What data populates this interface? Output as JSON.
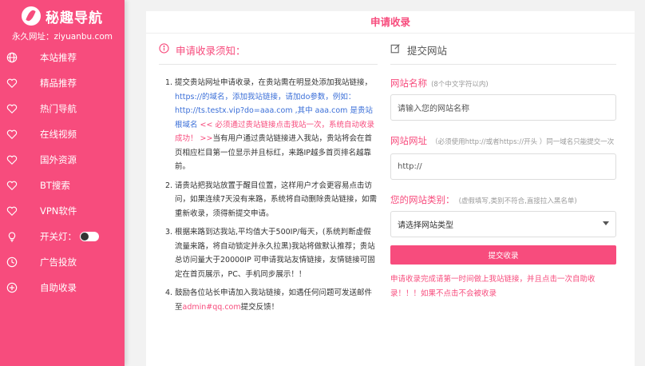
{
  "brand": {
    "name": "秘趣导航",
    "subtitle": "永久网址：ziyuanbu.com"
  },
  "nav": [
    {
      "label": "本站推荐",
      "icon": "globe-icon"
    },
    {
      "label": "精品推荐",
      "icon": "heart-icon"
    },
    {
      "label": "热门导航",
      "icon": "heart-icon"
    },
    {
      "label": "在线视频",
      "icon": "heart-icon"
    },
    {
      "label": "国外资源",
      "icon": "heart-icon"
    },
    {
      "label": "BT搜索",
      "icon": "heart-icon"
    },
    {
      "label": "VPN软件",
      "icon": "heart-icon"
    },
    {
      "label": "开关灯：",
      "icon": "lightbulb-icon"
    },
    {
      "label": "广告投放",
      "icon": "clock-icon"
    },
    {
      "label": "自助收录",
      "icon": "plus-circle-icon"
    }
  ],
  "page": {
    "title": "申请收录"
  },
  "notice": {
    "heading": "申请收录须知：",
    "items": [
      {
        "num": "1.",
        "t1": "提交贵站网址申请收录，在贵站需在明显处添加我站链接，",
        "t2": "https://的域名，添加我站链接，请加do参数，例如：http://ts.testx.vip?do=aaa.com ,其中 aaa.com 是贵站根域名",
        "t3": " << 必须通过贵站链接点击我站一次，系统自动收录成功！ >>",
        "t4": "当有用户通过贵站链接进入我站，贵站将会在首页相应栏目第一位显示并且标红，来路IP越多首页排名越靠前。"
      },
      {
        "num": "2.",
        "text": "请贵站把我站放置于醒目位置，这样用户才会更容易点击访问，如果连续7天没有来路，系统将自动删除贵站链接，如需重新收录，须得新提交申请。"
      },
      {
        "num": "3.",
        "text": "根据来路到达我站,平均值大于500IP/每天，(系统判断虚假流量来路，将自动锁定并永久拉黑)我站将做默认推荐；贵站总访问量大于20000IP 可申请我站友情链接，友情链接可固定在首页展示，PC、手机同步展示！！"
      },
      {
        "num": "4.",
        "t1": "鼓励各位站长申请加入我站链接，如遇任何问题可发送邮件至",
        "email": "admin#qq.com",
        "t2": "提交反馈！"
      }
    ]
  },
  "form": {
    "heading": "提交网站",
    "name_label": "网站名称",
    "name_hint": "(8个中文字符以内)",
    "name_placeholder": "请输入您的网站名称",
    "url_label": "网站网址",
    "url_hint": "（必须使用http://或者https://开头 ）同一域名只能提交一次",
    "url_value": "http://",
    "type_label": "您的网站类别：",
    "type_hint": "(虚假填写,类别不符合,直接拉入黑名单)",
    "type_value": "请选择网站类型",
    "submit": "提交收录",
    "footnote": "申请收录完成请第一时间做上我站链接，并且点击一次自助收录！！！如果不点击不会被收录"
  },
  "colors": {
    "accent": "#f74c7d",
    "link": "#3b6fd8"
  }
}
